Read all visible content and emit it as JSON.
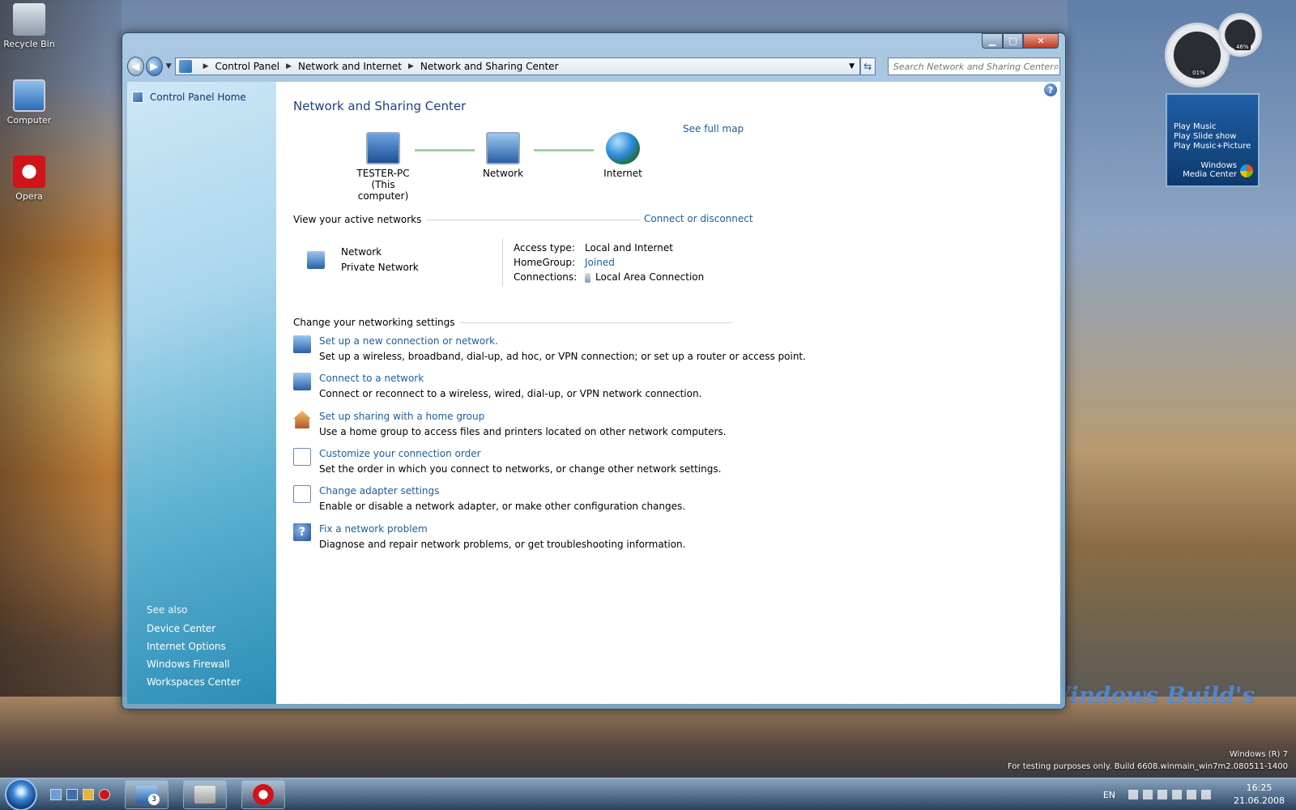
{
  "desktop": {
    "icons": [
      {
        "label": "Recycle Bin"
      },
      {
        "label": "Computer"
      },
      {
        "label": "Opera"
      }
    ],
    "watermark_line1": "Windows (R) 7",
    "watermark_line2": "For testing purposes only. Build 6608.winmain_win7m2.080511-1400",
    "logo_text": "Windows Build's"
  },
  "gadgets": {
    "meter": {
      "cpu": "01%",
      "memory": "46%"
    },
    "media_center": {
      "items": [
        "Play Music",
        "Play Slide show",
        "Play Music+Picture"
      ],
      "brand_line1": "Windows",
      "brand_line2": "Media Center"
    }
  },
  "window": {
    "breadcrumb": [
      "Control Panel",
      "Network and Internet",
      "Network and Sharing Center"
    ],
    "search_placeholder": "Search Network and Sharing Center for...",
    "nav": {
      "home": "Control Panel Home",
      "see_also_header": "See also",
      "see_also": [
        "Device Center",
        "Internet Options",
        "Windows Firewall",
        "Workspaces Center"
      ]
    },
    "title": "Network and Sharing Center",
    "see_full_map": "See full map",
    "map": {
      "computer_name": "TESTER-PC",
      "computer_sub": "(This computer)",
      "network": "Network",
      "internet": "Internet"
    },
    "active_networks_header": "View your active networks",
    "connect_or_disconnect": "Connect or disconnect",
    "active_network": {
      "name": "Network",
      "type": "Private Network",
      "access_type_label": "Access type:",
      "access_type_value": "Local and Internet",
      "homegroup_label": "HomeGroup:",
      "homegroup_value": "Joined",
      "connections_label": "Connections:",
      "connections_value": "Local Area Connection"
    },
    "change_settings_header": "Change your networking settings",
    "tasks": [
      {
        "title": "Set up a new connection or network.",
        "desc": "Set up a wireless, broadband, dial-up, ad hoc, or VPN connection; or set up a router or access point."
      },
      {
        "title": "Connect to a network",
        "desc": "Connect or reconnect to a wireless, wired, dial-up, or VPN network connection."
      },
      {
        "title": "Set up sharing with a home group",
        "desc": "Use a home group to access files and printers located on other network computers."
      },
      {
        "title": "Customize your connection order",
        "desc": "Set the order in which you connect to networks, or change other network settings."
      },
      {
        "title": "Change adapter settings",
        "desc": "Enable or disable a network adapter, or make other configuration changes."
      },
      {
        "title": "Fix a network problem",
        "desc": "Diagnose and repair network problems, or get troubleshooting information."
      }
    ]
  },
  "taskbar": {
    "network_badge": "3",
    "language": "EN",
    "time": "16:25",
    "date": "21.06.2008"
  }
}
